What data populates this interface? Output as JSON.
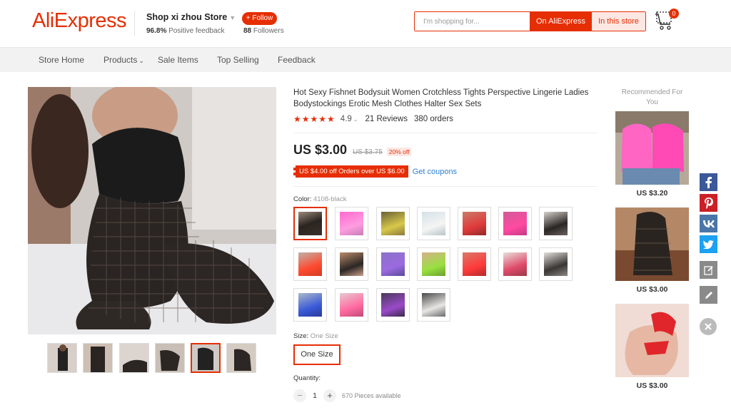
{
  "header": {
    "logo": "AliExpress",
    "store_name": "Shop xi zhou Store",
    "feedback_percent": "96.8%",
    "feedback_text": "Positive feedback",
    "follow_label": "+ Follow",
    "followers_count": "88",
    "followers_text": "Followers",
    "search_placeholder": "I'm shopping for...",
    "btn_on_aliexpress": "On AliExpress",
    "btn_in_store": "In this store",
    "cart_count": "0"
  },
  "nav": {
    "items": [
      "Store Home",
      "Products",
      "Sale Items",
      "Top Selling",
      "Feedback"
    ]
  },
  "product": {
    "title": "Hot Sexy Fishnet Bodysuit Women Crotchless Tights Perspective Lingerie Ladies Bodystockings Erotic Mesh Clothes Halter Sex Sets",
    "stars": "★★★★★",
    "rating": "4.9",
    "reviews": "21 Reviews",
    "orders": "380 orders",
    "price": "US $3.00",
    "old_price": "US $3.75",
    "discount": "20% off",
    "coupon_text": "US $4.00 off Orders over US $6.00",
    "get_coupons": "Get coupons",
    "color_label": "Color:",
    "color_value": "4108-black",
    "size_label": "Size:",
    "size_value": "One Size",
    "size_option": "One Size",
    "quantity_label": "Quantity:",
    "quantity_value": "1",
    "minus": "−",
    "plus": "+",
    "available": "670 Pieces available"
  },
  "recommended": {
    "title": "Recommended For You",
    "items": [
      {
        "price": "US $3.20"
      },
      {
        "price": "US $3.00"
      },
      {
        "price": "US $3.00"
      }
    ]
  },
  "colors": {
    "brand": "#e62e04",
    "link": "#2e7fd6",
    "nav_bg": "#f2f2f2"
  }
}
